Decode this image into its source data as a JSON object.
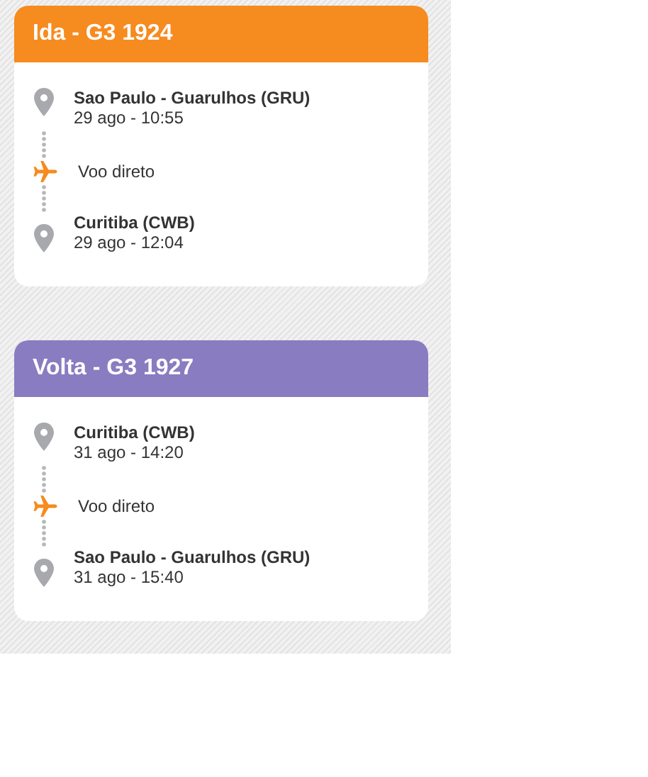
{
  "flights": [
    {
      "title": "Ida - G3 1924",
      "color": "#f68b1f",
      "departure": {
        "place": "Sao Paulo - Guarulhos (GRU)",
        "time": "29 ago - 10:55"
      },
      "connection": "Voo direto",
      "arrival": {
        "place": "Curitiba (CWB)",
        "time": "29 ago - 12:04"
      }
    },
    {
      "title": "Volta - G3 1927",
      "color": "#8a7cc0",
      "departure": {
        "place": "Curitiba (CWB)",
        "time": "31 ago - 14:20"
      },
      "connection": "Voo direto",
      "arrival": {
        "place": "Sao Paulo - Guarulhos (GRU)",
        "time": "31 ago - 15:40"
      }
    }
  ]
}
